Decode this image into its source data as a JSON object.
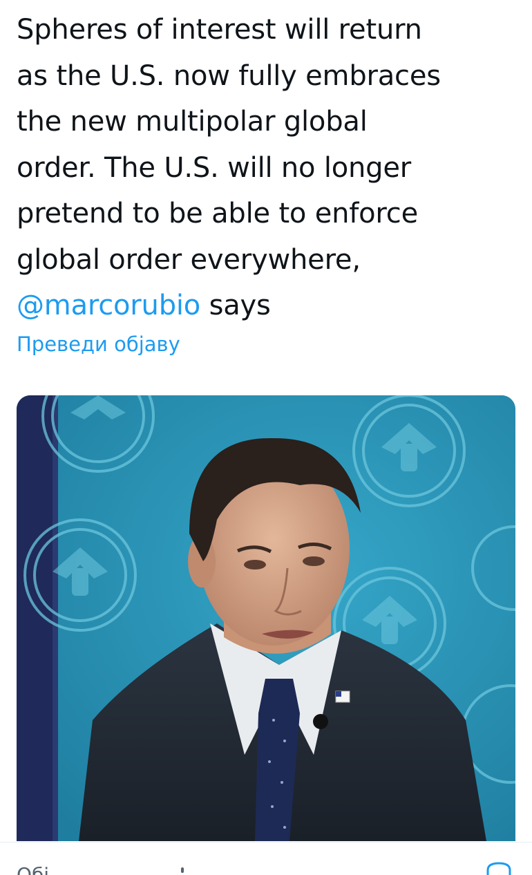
{
  "tweet": {
    "text_lines": [
      "Spheres of interest will return",
      "as the U.S. now fully embraces",
      "the new multipolar global",
      "order. The U.S. will no longer",
      "pretend to be able to enforce",
      "global order everywhere,"
    ],
    "mention": "@marcorubio",
    "mention_suffix": " says",
    "translate_label": "Преведи објаву"
  },
  "media": {
    "description_icon": "photo-icon"
  },
  "bottom": {
    "label": "Обј",
    "icon": "share-icon"
  },
  "colors": {
    "text": "#0f1419",
    "accent": "#1d9bf0",
    "muted": "#536471",
    "backdrop": "#2a8fb0"
  }
}
